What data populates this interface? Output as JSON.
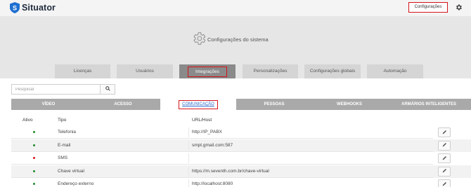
{
  "app": {
    "name": "Situator"
  },
  "top": {
    "config_label": "Configurações"
  },
  "page": {
    "title": "Configurações do sistema"
  },
  "main_tabs": [
    {
      "label": "Licenças",
      "active": false
    },
    {
      "label": "Usuários",
      "active": false
    },
    {
      "label": "Integrações",
      "active": true
    },
    {
      "label": "Personalizações",
      "active": false
    },
    {
      "label": "Configurações globais",
      "active": false
    },
    {
      "label": "Automação",
      "active": false
    }
  ],
  "search": {
    "placeholder": "Pesquisar",
    "value": ""
  },
  "sub_tabs": [
    {
      "label": "VÍDEO",
      "active": false
    },
    {
      "label": "ACESSO",
      "active": false
    },
    {
      "label": "COMUNICAÇÃO",
      "active": true
    },
    {
      "label": "PESSOAS",
      "active": false
    },
    {
      "label": "WEBHOOKS",
      "active": false
    },
    {
      "label": "ARMÁRIOS INTELIGENTES",
      "active": false
    }
  ],
  "table": {
    "headers": {
      "ativo": "Ativo",
      "tipo": "Tipo",
      "url": "URL/Host"
    },
    "rows": [
      {
        "active": true,
        "tipo": "Telefonia",
        "url": "http://IP_PABX"
      },
      {
        "active": true,
        "tipo": "E-mail",
        "url": "smpt.gmail.com:587"
      },
      {
        "active": false,
        "tipo": "SMS",
        "url": ""
      },
      {
        "active": true,
        "tipo": "Chave virtual",
        "url": "https://m.seventh.com.br/chave-virtual"
      },
      {
        "active": true,
        "tipo": "Endereço externo",
        "url": "http://localhost:8080"
      }
    ]
  },
  "colors": {
    "active_dot": "#1f8a2c",
    "inactive_dot": "#d3141a",
    "highlight": "#d3141a",
    "brand": "#2a6ac9"
  }
}
